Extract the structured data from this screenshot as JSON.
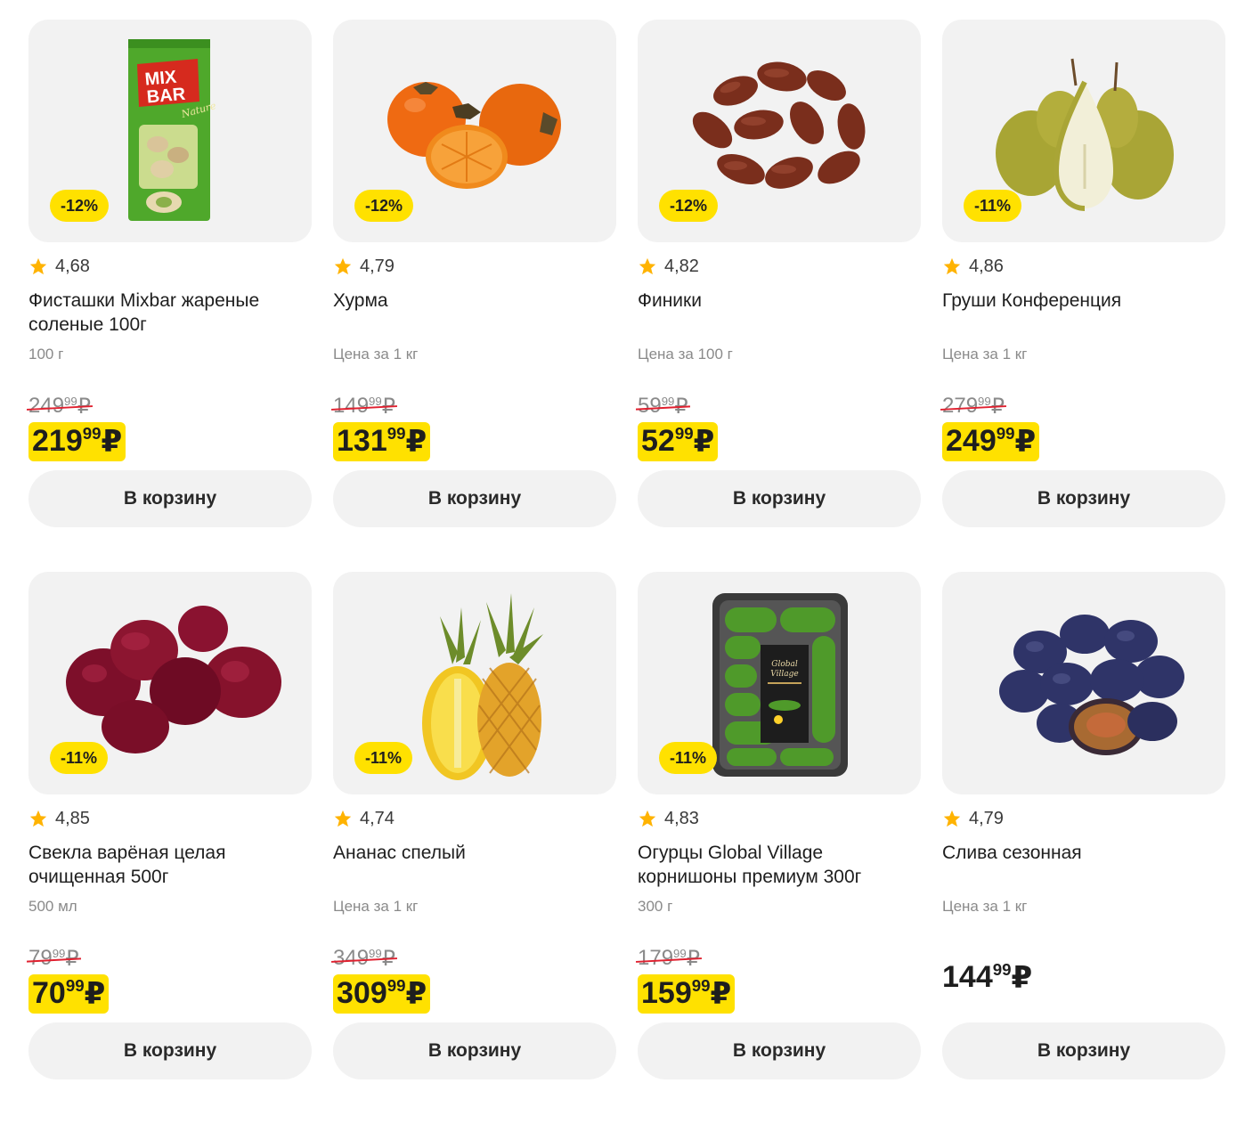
{
  "colors": {
    "accent": "#ffe100",
    "card_bg": "#f2f2f2",
    "strike": "#e0202f",
    "star": "#ffb300"
  },
  "products": [
    {
      "name": "Фисташки Mixbar жареные соленые 100г",
      "discount": "-12%",
      "rating": "4,68",
      "unit": "100 г",
      "old_price": {
        "int": "249",
        "frac": "99",
        "cur": "₽"
      },
      "price": {
        "int": "219",
        "frac": "99",
        "cur": "₽"
      },
      "button": "В корзину",
      "image": "pistachio-pack-image",
      "pack_text": "MIX BAR"
    },
    {
      "name": "Хурма",
      "discount": "-12%",
      "rating": "4,79",
      "unit": "Цена за 1 кг",
      "old_price": {
        "int": "149",
        "frac": "99",
        "cur": "₽"
      },
      "price": {
        "int": "131",
        "frac": "99",
        "cur": "₽"
      },
      "button": "В корзину",
      "image": "persimmon-image"
    },
    {
      "name": "Финики",
      "discount": "-12%",
      "rating": "4,82",
      "unit": "Цена за 100 г",
      "old_price": {
        "int": "59",
        "frac": "99",
        "cur": "₽"
      },
      "price": {
        "int": "52",
        "frac": "99",
        "cur": "₽"
      },
      "button": "В корзину",
      "image": "dates-image"
    },
    {
      "name": "Груши Конференция",
      "discount": "-11%",
      "rating": "4,86",
      "unit": "Цена за 1 кг",
      "old_price": {
        "int": "279",
        "frac": "99",
        "cur": "₽"
      },
      "price": {
        "int": "249",
        "frac": "99",
        "cur": "₽"
      },
      "button": "В корзину",
      "image": "pears-image"
    },
    {
      "name": "Свекла варёная целая очищенная 500г",
      "discount": "-11%",
      "rating": "4,85",
      "unit": "500 мл",
      "old_price": {
        "int": "79",
        "frac": "99",
        "cur": "₽"
      },
      "price": {
        "int": "70",
        "frac": "99",
        "cur": "₽"
      },
      "button": "В корзину",
      "image": "beetroot-image"
    },
    {
      "name": "Ананас спелый",
      "discount": "-11%",
      "rating": "4,74",
      "unit": "Цена за 1 кг",
      "old_price": {
        "int": "349",
        "frac": "99",
        "cur": "₽"
      },
      "price": {
        "int": "309",
        "frac": "99",
        "cur": "₽"
      },
      "button": "В корзину",
      "image": "pineapple-image"
    },
    {
      "name": "Огурцы Global Village корнишоны премиум 300г",
      "discount": "-11%",
      "rating": "4,83",
      "unit": "300 г",
      "old_price": {
        "int": "179",
        "frac": "99",
        "cur": "₽"
      },
      "price": {
        "int": "159",
        "frac": "99",
        "cur": "₽"
      },
      "button": "В корзину",
      "image": "cucumbers-tray-image",
      "pack_text": "Global Village"
    },
    {
      "name": "Слива сезонная",
      "discount": "",
      "rating": "4,79",
      "unit": "Цена за 1 кг",
      "old_price": null,
      "price": {
        "int": "144",
        "frac": "99",
        "cur": "₽"
      },
      "button": "В корзину",
      "image": "plums-image"
    }
  ]
}
